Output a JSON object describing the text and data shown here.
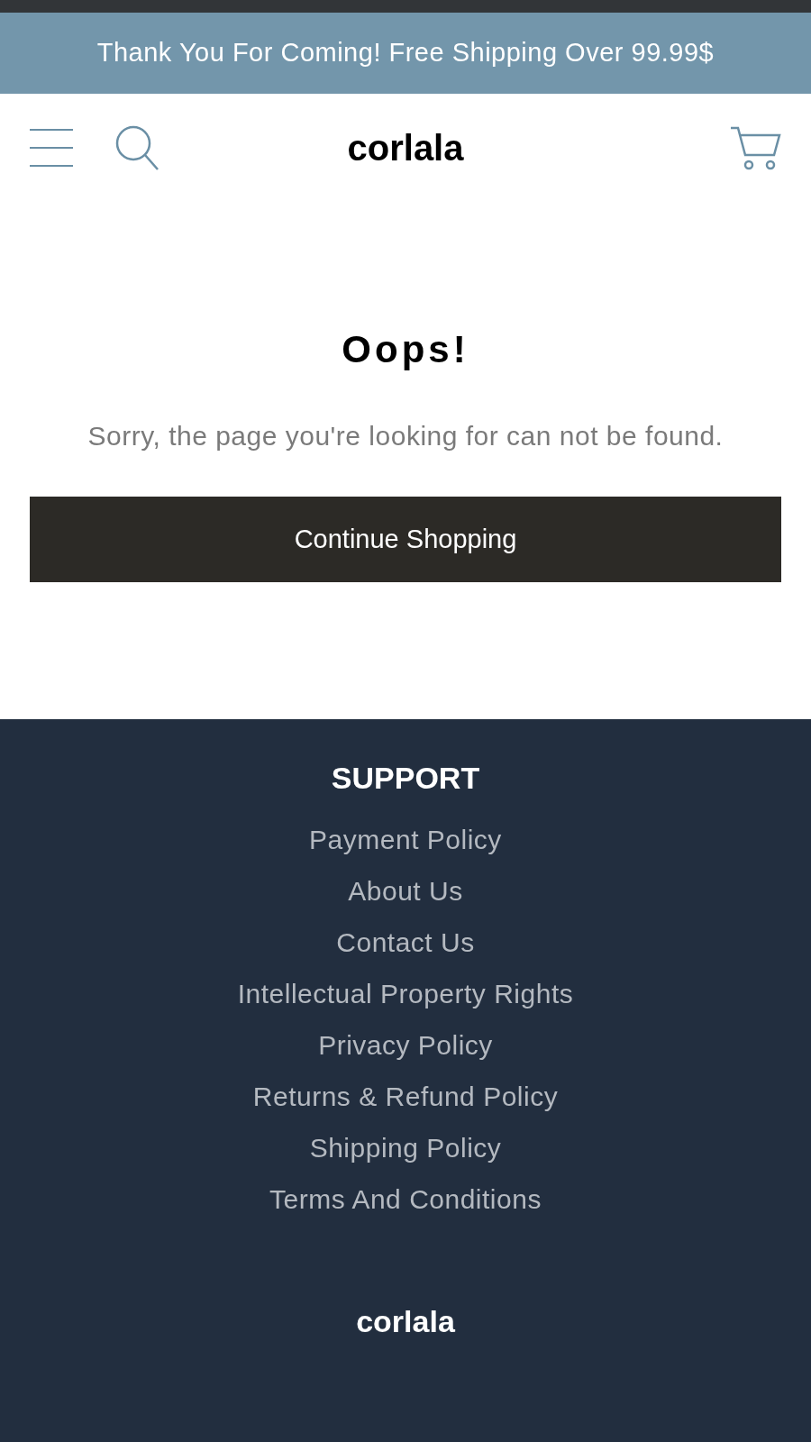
{
  "announcement": "Thank You For Coming! Free Shipping Over 99.99$",
  "header": {
    "logo": "corlala"
  },
  "error": {
    "title": "Oops!",
    "message": "Sorry, the page you're looking for can not be found.",
    "button": "Continue Shopping"
  },
  "footer": {
    "heading": "SUPPORT",
    "links": [
      "Payment Policy",
      "About Us",
      "Contact Us",
      "Intellectual Property Rights",
      "Privacy Policy",
      "Returns & Refund Policy",
      "Shipping Policy",
      "Terms And Conditions"
    ],
    "logo": "corlala"
  }
}
